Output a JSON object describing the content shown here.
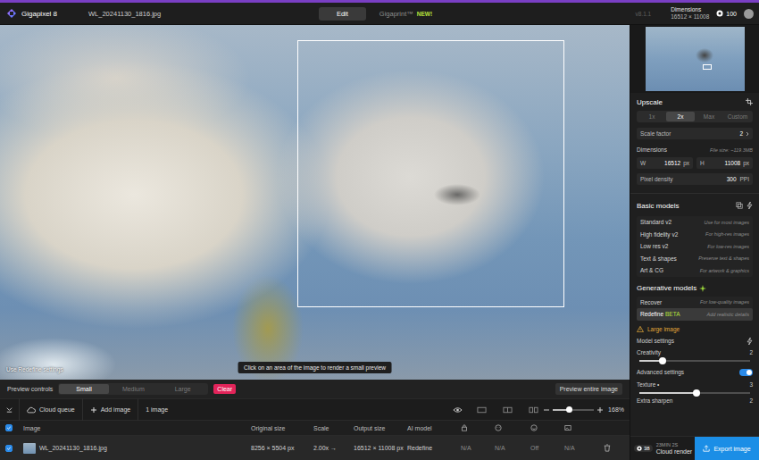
{
  "app": {
    "name": "Gigapixel 8",
    "file": "WL_20241130_1816.jpg"
  },
  "nav_tabs": [
    {
      "label": "Edit",
      "selected": true,
      "badge": ""
    },
    {
      "label": "Gigaprint™",
      "selected": false,
      "badge": "NEW!"
    }
  ],
  "header_right": {
    "version": "v8.1.1",
    "dimensions_label": "Dimensions",
    "dimensions": "16512 × 11008",
    "credits": "100"
  },
  "canvas": {
    "overlay_label": "Use Redefine settings",
    "tooltip": "Click on an area of the image to render a small preview"
  },
  "preview_controls": {
    "label": "Preview controls",
    "sizes": [
      {
        "label": "Small",
        "selected": true
      },
      {
        "label": "Medium",
        "selected": false
      },
      {
        "label": "Large",
        "selected": false
      }
    ],
    "clear": "Clear",
    "preview_entire": "Preview entire image"
  },
  "toolbar": {
    "cloud_queue": "Cloud queue",
    "add_image": "Add image",
    "count": "1 image",
    "zoom": "168%",
    "zoom_level": 0.4
  },
  "table": {
    "all_checked": true,
    "columns": [
      "Image",
      "Original size",
      "Scale",
      "Output size",
      "AI model"
    ],
    "rows": [
      {
        "checked": true,
        "cells": [
          "WL_20241130_1816.jpg",
          "8256 × 5504 px",
          "2.00x →",
          "16512 × 11008 px",
          "Redefine",
          "N/A",
          "N/A",
          "Off",
          "N/A"
        ]
      }
    ]
  },
  "upscale": {
    "title": "Upscale",
    "scale_options": [
      {
        "label": "1x",
        "selected": false
      },
      {
        "label": "2x",
        "selected": true
      },
      {
        "label": "Max",
        "selected": false
      },
      {
        "label": "Custom",
        "selected": false
      }
    ],
    "scale_factor_label": "Scale factor",
    "scale_factor": "2",
    "dimensions_label": "Dimensions",
    "file_size": "File size: ~119.3MB",
    "width_label": "W",
    "width": "16512",
    "width_unit": "px",
    "height_label": "H",
    "height": "11008",
    "height_unit": "px",
    "density_label": "Pixel density",
    "density": "300",
    "density_unit": "PPI"
  },
  "basic_models": {
    "title": "Basic models",
    "items": [
      {
        "name": "Standard v2",
        "badge": "",
        "desc": "Use for most images",
        "selected": false
      },
      {
        "name": "High fidelity v2",
        "badge": "",
        "desc": "For high-res images",
        "selected": false
      },
      {
        "name": "Low res v2",
        "badge": "",
        "desc": "For low-res images",
        "selected": false
      },
      {
        "name": "Text & shapes",
        "badge": "",
        "desc": "Preserve text & shapes",
        "selected": false
      },
      {
        "name": "Art & CG",
        "badge": "",
        "desc": "For artwork & graphics",
        "selected": false
      }
    ]
  },
  "generative_models": {
    "title": "Generative models",
    "items": [
      {
        "name": "Recover",
        "badge": "",
        "desc": "For low-quality images",
        "selected": false
      },
      {
        "name": "Redefine",
        "badge": "BETA",
        "desc": "Add realistic details",
        "selected": true
      }
    ]
  },
  "warning": "Large image",
  "model_settings": {
    "title": "Model settings",
    "creativity_label": "Creativity",
    "creativity": "2",
    "creativity_level": 0.21,
    "advanced_label": "Advanced settings",
    "advanced_on": true,
    "texture_label": "Texture •",
    "texture": "3",
    "texture_level": 0.52,
    "sharpen_label": "Extra sharpen",
    "sharpen": "2"
  },
  "footer": {
    "credits": "38",
    "time": "23MIN 2S",
    "render_label": "Cloud render",
    "export": "Export image"
  }
}
